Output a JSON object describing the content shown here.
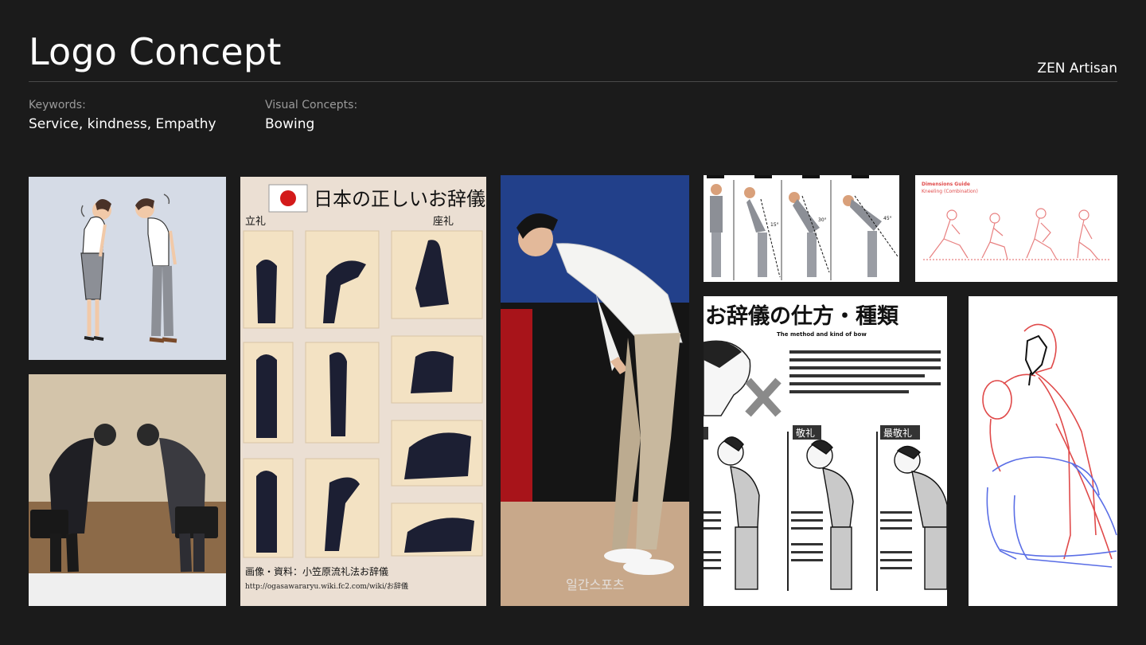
{
  "header": {
    "title": "Logo Concept",
    "brand": "ZEN Artisan"
  },
  "meta": {
    "keywords_label": "Keywords:",
    "keywords_value": "Service, kindness, Empathy",
    "visual_label": "Visual Concepts:",
    "visual_value": "Bowing"
  },
  "moodboard": {
    "poster": {
      "title": "日本の正しいお辞儀",
      "left_label": "立礼",
      "right_label": "座礼",
      "credit": "画像・資料：小笠原流礼法お辞儀",
      "url": "http://ogasawararyu.wiki.fc2.com/wiki/お辞儀"
    },
    "angles": {
      "a1": "15°",
      "a2": "30°",
      "a3": "45°"
    },
    "dimensions": {
      "title": "Dimensions Guide",
      "subtitle": "Kneeling (Combination)"
    },
    "manual": {
      "title": "お辞儀の仕方・種類",
      "subtitle": "The method and kind of bow",
      "label_1": "敬礼",
      "label_2": "最敬礼"
    },
    "photo_watermark": "일간스포츠"
  },
  "colors": {
    "background": "#1b1b1b",
    "accent_red": "#e04a4a",
    "sketch_blue": "#5a6ee6"
  }
}
